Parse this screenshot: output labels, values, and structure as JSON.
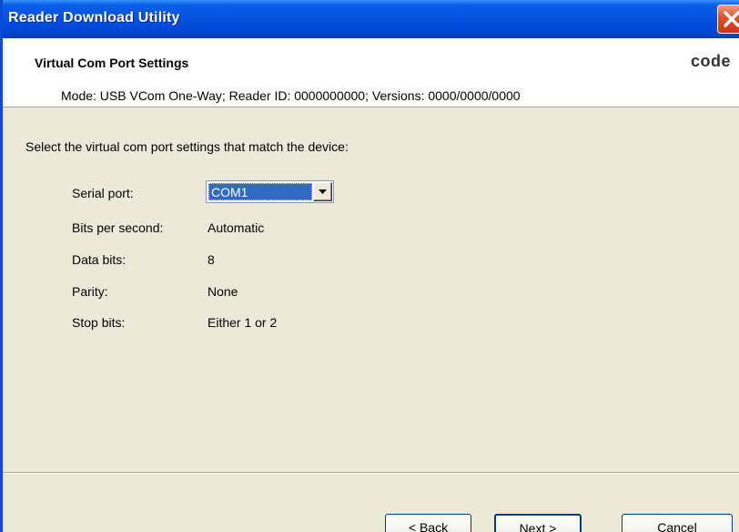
{
  "window": {
    "title": "Reader Download Utility"
  },
  "header": {
    "title": "Virtual Com Port Settings",
    "mode_line": "Mode: USB VCom One-Way; Reader ID: 0000000000; Versions: 0000/0000/0000",
    "logo_text": "code"
  },
  "main": {
    "instruction": "Select the virtual com port settings that match the device:",
    "serial_port": {
      "label": "Serial port:",
      "value": "COM1"
    },
    "bits_per_second": {
      "label": "Bits per second:",
      "value": "Automatic"
    },
    "data_bits": {
      "label": "Data bits:",
      "value": "8"
    },
    "parity": {
      "label": "Parity:",
      "value": "None"
    },
    "stop_bits": {
      "label": "Stop bits:",
      "value": "Either 1 or 2"
    }
  },
  "footer": {
    "back_label": "< Back",
    "next_label": "Next >",
    "cancel_label": "Cancel"
  },
  "colors": {
    "titlebar": "#0553E0",
    "dialog_bg": "#ECE9D8",
    "selection": "#316AC5",
    "close_button": "#E0542A"
  },
  "icons": {
    "close": "close-icon",
    "dropdown": "chevron-down-icon"
  }
}
